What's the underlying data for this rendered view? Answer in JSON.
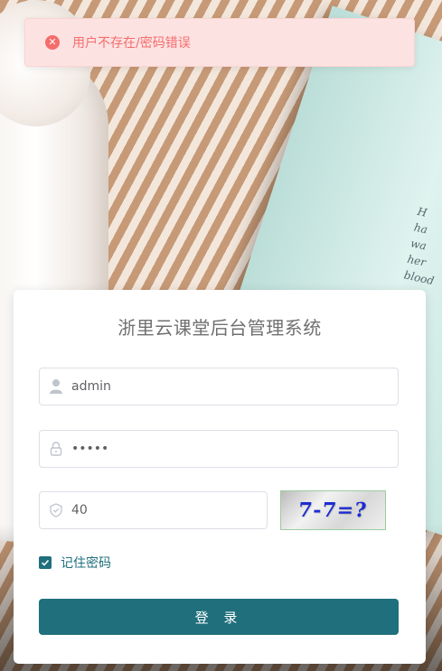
{
  "alert": {
    "type": "error",
    "message": "用户不存在/密码错误",
    "icon": "close-circle-icon",
    "color": "#f56c6c",
    "background": "#fde2e2"
  },
  "login": {
    "title": "浙里云课堂后台管理系统",
    "username": {
      "value": "admin",
      "icon": "user-icon"
    },
    "password": {
      "value": "•••••",
      "icon": "lock-icon"
    },
    "captcha": {
      "value": "40",
      "icon": "shield-icon",
      "image_text": "7-7=?"
    },
    "remember": {
      "label": "记住密码",
      "checked": true
    },
    "submit_label": "登 录",
    "accent_color": "#1f6f7c"
  }
}
